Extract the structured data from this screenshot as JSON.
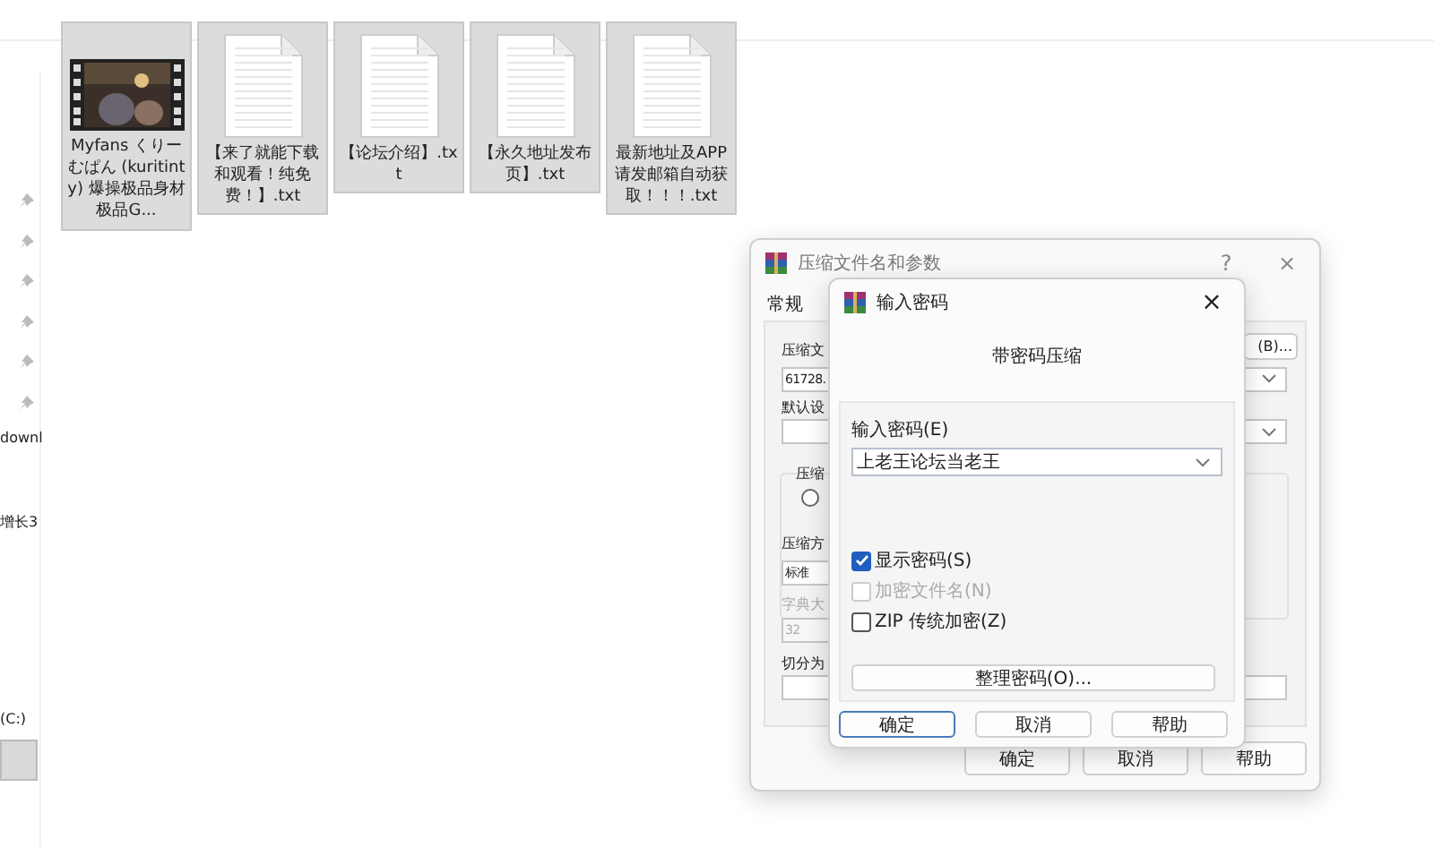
{
  "explorer": {
    "nav_texts": [
      "downl",
      "增长3",
      "(C:)"
    ],
    "files": [
      {
        "kind": "video",
        "name": "Myfans くりーむぱん (kuritinty) 爆操极品身材极品G...",
        "selected": true
      },
      {
        "kind": "text",
        "name": "【来了就能下载和观看！纯免费！】.txt",
        "selected": true
      },
      {
        "kind": "text",
        "name": "【论坛介绍】.txt",
        "selected": true
      },
      {
        "kind": "text",
        "name": "【永久地址发布页】.txt",
        "selected": true
      },
      {
        "kind": "text",
        "name": "最新地址及APP请发邮箱自动获取！！！.txt",
        "selected": true
      }
    ]
  },
  "archive_dialog": {
    "title": "压缩文件名和参数",
    "help": "?",
    "close": "×",
    "tab": "常规",
    "labels": [
      "压缩文",
      "默认设",
      "压缩",
      "压缩方",
      "字典大",
      "切分为"
    ],
    "radio": {
      "selected": false
    },
    "filename": "61728.",
    "browse": "(B)...",
    "method": "标准",
    "dictionary": "32",
    "buttons": [
      "确定",
      "取消",
      "帮助"
    ]
  },
  "password_dialog": {
    "title": "输入密码",
    "close": "×",
    "heading": "带密码压缩",
    "field_label": "输入密码(E)",
    "password": "上老王论坛当老王",
    "options": [
      {
        "label": "显示密码(S)",
        "checked": true,
        "disabled": false
      },
      {
        "label": "加密文件名(N)",
        "checked": false,
        "disabled": true
      },
      {
        "label": "ZIP 传统加密(Z)",
        "checked": false,
        "disabled": false
      }
    ],
    "organize": "整理密码(O)...",
    "buttons": [
      {
        "label": "确定",
        "selected": true
      },
      {
        "label": "取消",
        "selected": false
      },
      {
        "label": "帮助",
        "selected": false
      }
    ]
  }
}
